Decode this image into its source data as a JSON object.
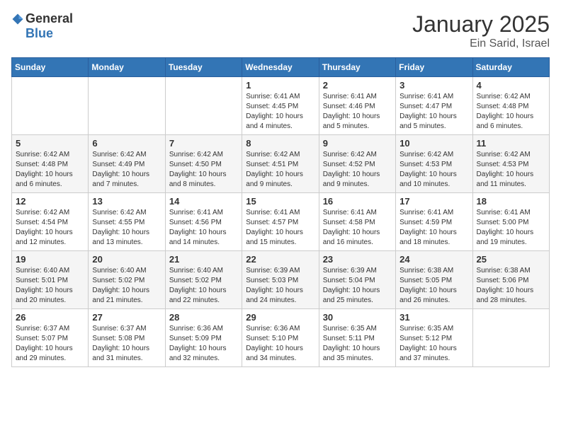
{
  "logo": {
    "general": "General",
    "blue": "Blue"
  },
  "title": "January 2025",
  "subtitle": "Ein Sarid, Israel",
  "days_of_week": [
    "Sunday",
    "Monday",
    "Tuesday",
    "Wednesday",
    "Thursday",
    "Friday",
    "Saturday"
  ],
  "weeks": [
    [
      {
        "num": "",
        "lines": []
      },
      {
        "num": "",
        "lines": []
      },
      {
        "num": "",
        "lines": []
      },
      {
        "num": "1",
        "lines": [
          "Sunrise: 6:41 AM",
          "Sunset: 4:45 PM",
          "Daylight: 10 hours",
          "and 4 minutes."
        ]
      },
      {
        "num": "2",
        "lines": [
          "Sunrise: 6:41 AM",
          "Sunset: 4:46 PM",
          "Daylight: 10 hours",
          "and 5 minutes."
        ]
      },
      {
        "num": "3",
        "lines": [
          "Sunrise: 6:41 AM",
          "Sunset: 4:47 PM",
          "Daylight: 10 hours",
          "and 5 minutes."
        ]
      },
      {
        "num": "4",
        "lines": [
          "Sunrise: 6:42 AM",
          "Sunset: 4:48 PM",
          "Daylight: 10 hours",
          "and 6 minutes."
        ]
      }
    ],
    [
      {
        "num": "5",
        "lines": [
          "Sunrise: 6:42 AM",
          "Sunset: 4:48 PM",
          "Daylight: 10 hours",
          "and 6 minutes."
        ]
      },
      {
        "num": "6",
        "lines": [
          "Sunrise: 6:42 AM",
          "Sunset: 4:49 PM",
          "Daylight: 10 hours",
          "and 7 minutes."
        ]
      },
      {
        "num": "7",
        "lines": [
          "Sunrise: 6:42 AM",
          "Sunset: 4:50 PM",
          "Daylight: 10 hours",
          "and 8 minutes."
        ]
      },
      {
        "num": "8",
        "lines": [
          "Sunrise: 6:42 AM",
          "Sunset: 4:51 PM",
          "Daylight: 10 hours",
          "and 9 minutes."
        ]
      },
      {
        "num": "9",
        "lines": [
          "Sunrise: 6:42 AM",
          "Sunset: 4:52 PM",
          "Daylight: 10 hours",
          "and 9 minutes."
        ]
      },
      {
        "num": "10",
        "lines": [
          "Sunrise: 6:42 AM",
          "Sunset: 4:53 PM",
          "Daylight: 10 hours",
          "and 10 minutes."
        ]
      },
      {
        "num": "11",
        "lines": [
          "Sunrise: 6:42 AM",
          "Sunset: 4:53 PM",
          "Daylight: 10 hours",
          "and 11 minutes."
        ]
      }
    ],
    [
      {
        "num": "12",
        "lines": [
          "Sunrise: 6:42 AM",
          "Sunset: 4:54 PM",
          "Daylight: 10 hours",
          "and 12 minutes."
        ]
      },
      {
        "num": "13",
        "lines": [
          "Sunrise: 6:42 AM",
          "Sunset: 4:55 PM",
          "Daylight: 10 hours",
          "and 13 minutes."
        ]
      },
      {
        "num": "14",
        "lines": [
          "Sunrise: 6:41 AM",
          "Sunset: 4:56 PM",
          "Daylight: 10 hours",
          "and 14 minutes."
        ]
      },
      {
        "num": "15",
        "lines": [
          "Sunrise: 6:41 AM",
          "Sunset: 4:57 PM",
          "Daylight: 10 hours",
          "and 15 minutes."
        ]
      },
      {
        "num": "16",
        "lines": [
          "Sunrise: 6:41 AM",
          "Sunset: 4:58 PM",
          "Daylight: 10 hours",
          "and 16 minutes."
        ]
      },
      {
        "num": "17",
        "lines": [
          "Sunrise: 6:41 AM",
          "Sunset: 4:59 PM",
          "Daylight: 10 hours",
          "and 18 minutes."
        ]
      },
      {
        "num": "18",
        "lines": [
          "Sunrise: 6:41 AM",
          "Sunset: 5:00 PM",
          "Daylight: 10 hours",
          "and 19 minutes."
        ]
      }
    ],
    [
      {
        "num": "19",
        "lines": [
          "Sunrise: 6:40 AM",
          "Sunset: 5:01 PM",
          "Daylight: 10 hours",
          "and 20 minutes."
        ]
      },
      {
        "num": "20",
        "lines": [
          "Sunrise: 6:40 AM",
          "Sunset: 5:02 PM",
          "Daylight: 10 hours",
          "and 21 minutes."
        ]
      },
      {
        "num": "21",
        "lines": [
          "Sunrise: 6:40 AM",
          "Sunset: 5:02 PM",
          "Daylight: 10 hours",
          "and 22 minutes."
        ]
      },
      {
        "num": "22",
        "lines": [
          "Sunrise: 6:39 AM",
          "Sunset: 5:03 PM",
          "Daylight: 10 hours",
          "and 24 minutes."
        ]
      },
      {
        "num": "23",
        "lines": [
          "Sunrise: 6:39 AM",
          "Sunset: 5:04 PM",
          "Daylight: 10 hours",
          "and 25 minutes."
        ]
      },
      {
        "num": "24",
        "lines": [
          "Sunrise: 6:38 AM",
          "Sunset: 5:05 PM",
          "Daylight: 10 hours",
          "and 26 minutes."
        ]
      },
      {
        "num": "25",
        "lines": [
          "Sunrise: 6:38 AM",
          "Sunset: 5:06 PM",
          "Daylight: 10 hours",
          "and 28 minutes."
        ]
      }
    ],
    [
      {
        "num": "26",
        "lines": [
          "Sunrise: 6:37 AM",
          "Sunset: 5:07 PM",
          "Daylight: 10 hours",
          "and 29 minutes."
        ]
      },
      {
        "num": "27",
        "lines": [
          "Sunrise: 6:37 AM",
          "Sunset: 5:08 PM",
          "Daylight: 10 hours",
          "and 31 minutes."
        ]
      },
      {
        "num": "28",
        "lines": [
          "Sunrise: 6:36 AM",
          "Sunset: 5:09 PM",
          "Daylight: 10 hours",
          "and 32 minutes."
        ]
      },
      {
        "num": "29",
        "lines": [
          "Sunrise: 6:36 AM",
          "Sunset: 5:10 PM",
          "Daylight: 10 hours",
          "and 34 minutes."
        ]
      },
      {
        "num": "30",
        "lines": [
          "Sunrise: 6:35 AM",
          "Sunset: 5:11 PM",
          "Daylight: 10 hours",
          "and 35 minutes."
        ]
      },
      {
        "num": "31",
        "lines": [
          "Sunrise: 6:35 AM",
          "Sunset: 5:12 PM",
          "Daylight: 10 hours",
          "and 37 minutes."
        ]
      },
      {
        "num": "",
        "lines": []
      }
    ]
  ]
}
